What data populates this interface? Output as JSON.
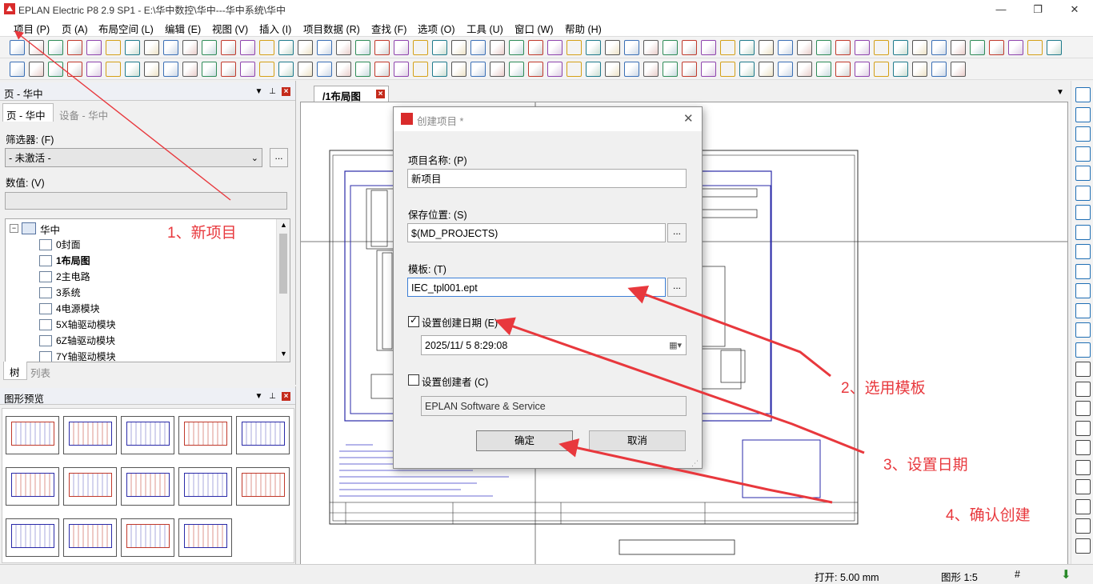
{
  "window": {
    "title": "EPLAN Electric P8 2.9 SP1 - E:\\华中数控\\华中---华中系统\\华中",
    "minimize": "—",
    "restore": "❐",
    "close": "✕"
  },
  "menu": [
    "项目 (P)",
    "页 (A)",
    "布局空间 (L)",
    "编辑 (E)",
    "视图 (V)",
    "插入 (I)",
    "项目数据 (R)",
    "查找 (F)",
    "选项 (O)",
    "工具 (U)",
    "窗口 (W)",
    "帮助 (H)"
  ],
  "pages_panel": {
    "title": "页 - 华中",
    "tabs": [
      "页 - 华中",
      "设备 - 华中"
    ],
    "filter_label": "筛选器: (F)",
    "filter_value": "- 未激活 -",
    "filter_btn": "...",
    "value_label": "数值: (V)",
    "value": "",
    "tree_root": "华中",
    "tree_items": [
      "0封面",
      "1布局图",
      "2主电路",
      "3系统",
      "4电源模块",
      "5X轴驱动模块",
      "6Z轴驱动模块",
      "7Y轴驱动模块"
    ],
    "bottom_tabs": [
      "树",
      "列表"
    ]
  },
  "preview_panel": {
    "title": "图形预览"
  },
  "document_tab": "/1布局图",
  "dialog": {
    "title": "创建项目 *",
    "project_name_label": "项目名称: (P)",
    "project_name_value": "新项目",
    "save_location_label": "保存位置: (S)",
    "save_location_value": "$(MD_PROJECTS)",
    "template_label": "模板: (T)",
    "template_value": "IEC_tpl001.ept",
    "set_date_label": "设置创建日期 (E)",
    "set_date_checked": true,
    "date_value": "2025/11/  5   8:29:08",
    "set_creator_label": "设置创建者 (C)",
    "set_creator_checked": false,
    "creator_value": "EPLAN Software & Service",
    "ok": "确定",
    "cancel": "取消",
    "browse": "..."
  },
  "annotations": [
    "1、新项目",
    "2、选用模板",
    "3、设置日期",
    "4、确认创建"
  ],
  "statusbar": {
    "snap": "打开: 5.00 mm",
    "scale": "图形 1:5",
    "grid": "#"
  },
  "colors": {
    "annotation_red": "#e8383d",
    "eplan_red": "#d92b2b",
    "drawing_blue": "#2a2aa8"
  }
}
